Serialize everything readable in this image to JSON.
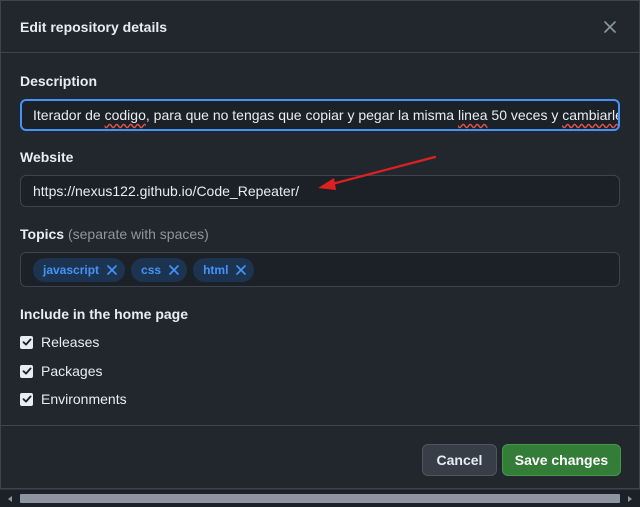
{
  "dialog": {
    "title": "Edit repository details",
    "close_icon": "close-icon"
  },
  "description": {
    "label": "Description",
    "value_parts": [
      "Iterador de ",
      "codigo",
      ", para que no tengas que copiar y pegar la misma ",
      "linea",
      " 50 veces y ",
      "cambiarle"
    ]
  },
  "website": {
    "label": "Website",
    "value": "https://nexus122.github.io/Code_Repeater/"
  },
  "topics": {
    "label": "Topics",
    "hint": "(separate with spaces)",
    "items": [
      "javascript",
      "css",
      "html"
    ]
  },
  "home_page": {
    "label": "Include in the home page",
    "options": [
      {
        "label": "Releases",
        "checked": true
      },
      {
        "label": "Packages",
        "checked": true
      },
      {
        "label": "Environments",
        "checked": true
      }
    ]
  },
  "buttons": {
    "cancel": "Cancel",
    "save": "Save changes"
  },
  "colors": {
    "accent": "#4493f8",
    "save_green": "#347d39",
    "annotation_arrow": "#e02020"
  }
}
